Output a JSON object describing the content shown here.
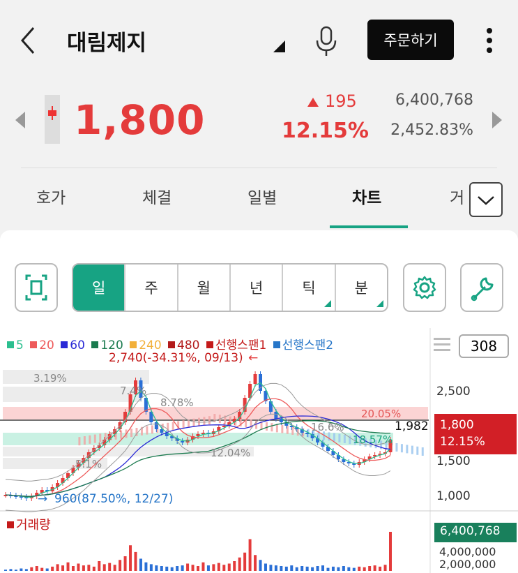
{
  "header": {
    "stock_name": "대림제지",
    "order_button": "주문하기",
    "icons": [
      "back-icon",
      "dropdown-icon",
      "mic-icon",
      "more-icon"
    ]
  },
  "quote": {
    "price": "1,800",
    "change": "195",
    "change_pct": "12.15%",
    "volume": "6,400,768",
    "volume_pct": "2,452.83%",
    "up_color": "#e43b3b"
  },
  "tabs": [
    {
      "label": "호가"
    },
    {
      "label": "체결"
    },
    {
      "label": "일별"
    },
    {
      "label": "차트"
    },
    {
      "label": "거"
    }
  ],
  "active_tab": "차트",
  "accent_color": "#17a383",
  "toolbar": {
    "periods": [
      {
        "label": "일"
      },
      {
        "label": "주"
      },
      {
        "label": "월"
      },
      {
        "label": "년"
      },
      {
        "label": "틱"
      },
      {
        "label": "분"
      }
    ],
    "active_period": "일"
  },
  "chart": {
    "legend": [
      {
        "label": "5",
        "color": "#2bbf8f"
      },
      {
        "label": "20",
        "color": "#ee5a5a"
      },
      {
        "label": "60",
        "color": "#2a2ad6"
      },
      {
        "label": "120",
        "color": "#1a7a4e"
      },
      {
        "label": "240",
        "color": "#f2b03a"
      },
      {
        "label": "480",
        "color": "#b31b1b"
      },
      {
        "label": "선행스팬1",
        "color": "#c41a1a"
      },
      {
        "label": "선행스팬2",
        "color": "#2776c8"
      }
    ],
    "candle_count": "308",
    "high_note": "2,740(-34.31%, 09/13)",
    "low_note": "960(87.50%, 12/27)",
    "fib_labels": [
      "3.19%",
      "7.4%",
      "8.78%",
      "20.05%",
      "16.6%",
      "18.57%",
      "12.04%",
      "5.1%"
    ],
    "last_close_label": "1,982",
    "price_tag": {
      "price": "1,800",
      "pct": "12.15%"
    },
    "volume_title": "거래량",
    "volume_tag": "6,400,768"
  },
  "chart_data": {
    "type": "candlestick",
    "y_ticks": [
      2500,
      2000,
      1500,
      1000
    ],
    "ylim": [
      900,
      2900
    ],
    "volume_ticks": [
      "4,000,000",
      "2,000,000"
    ],
    "close_series": [
      1010,
      1000,
      990,
      980,
      960,
      990,
      1040,
      1080,
      1060,
      1120,
      1180,
      1250,
      1320,
      1400,
      1470,
      1540,
      1620,
      1680,
      1720,
      1800,
      1880,
      1950,
      2050,
      2200,
      2450,
      2650,
      2400,
      2200,
      2050,
      1950,
      1900,
      1850,
      1820,
      1780,
      1760,
      1800,
      1850,
      1880,
      1900,
      1880,
      1920,
      1980,
      2000,
      2050,
      2100,
      2200,
      2400,
      2600,
      2740,
      2500,
      2350,
      2200,
      2100,
      2050,
      2000,
      1980,
      1950,
      1900,
      1880,
      1820,
      1760,
      1700,
      1640,
      1580,
      1520,
      1480,
      1460,
      1440,
      1480,
      1520,
      1560,
      1580,
      1600,
      1620,
      1800
    ],
    "volume_series": [
      0.2,
      0.3,
      0.2,
      0.4,
      0.3,
      0.6,
      0.8,
      0.5,
      0.4,
      0.7,
      1.1,
      0.9,
      1.4,
      0.8,
      1.2,
      0.9,
      1.0,
      0.7,
      1.6,
      1.1,
      1.3,
      1.0,
      1.8,
      2.4,
      4.2,
      3.1,
      2.0,
      1.4,
      1.1,
      0.9,
      0.8,
      0.7,
      0.6,
      0.8,
      0.9,
      1.2,
      1.0,
      0.8,
      1.4,
      0.9,
      1.1,
      1.3,
      1.0,
      1.2,
      1.6,
      2.2,
      3.0,
      5.2,
      2.6,
      1.8,
      1.2,
      1.0,
      0.9,
      0.8,
      0.7,
      0.9,
      0.6,
      0.8,
      0.7,
      0.6,
      0.8,
      0.9,
      0.5,
      0.7,
      0.6,
      0.8,
      0.6,
      0.5,
      0.7,
      0.6,
      0.8,
      0.9,
      0.7,
      1.0,
      6.4
    ]
  }
}
